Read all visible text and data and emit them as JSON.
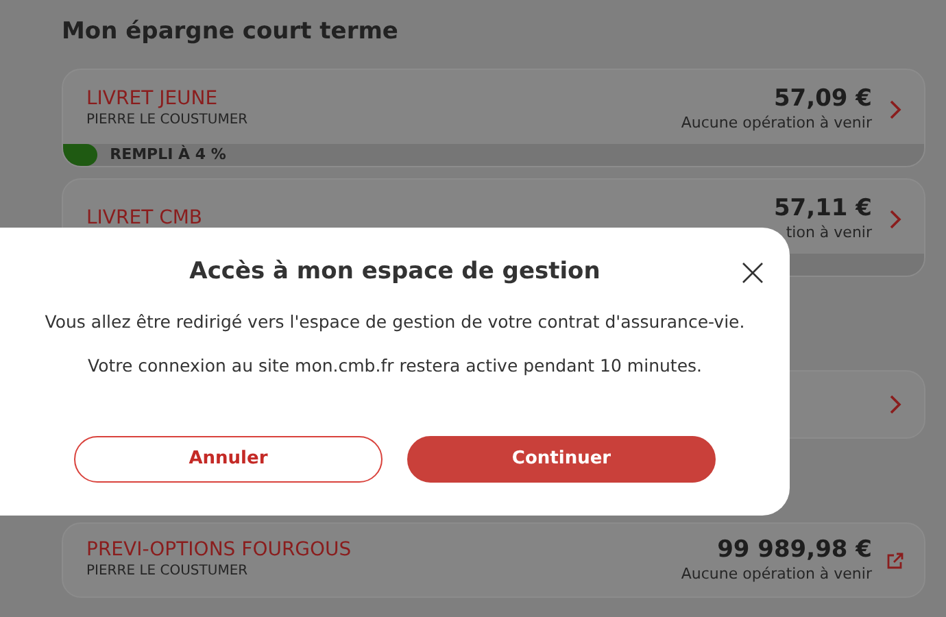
{
  "section_title": "Mon épargne court terme",
  "accounts": [
    {
      "name": "LIVRET JEUNE",
      "holder": "PIERRE LE COUSTUMER",
      "balance": "57,09 €",
      "status": "Aucune opération à venir",
      "kind": "chevron",
      "progress": {
        "label": "REMPLI À 4 %",
        "level": 0.04
      }
    },
    {
      "name": "LIVRET CMB",
      "balance": "57,11 €",
      "status": "tion à venir",
      "kind": "chevron",
      "strip": true
    },
    {
      "kind": "chevron"
    },
    {
      "name": "PREVI-OPTIONS FOURGOUS",
      "holder": "PIERRE LE COUSTUMER",
      "balance": "99 989,98 €",
      "status": "Aucune opération à venir",
      "kind": "external"
    }
  ],
  "dialog": {
    "title": "Accès à mon espace de gestion",
    "paragraphs": [
      "Vous allez être redirigé vers l'espace de gestion de votre contrat d'assurance-vie.",
      "Votre connexion au site mon.cmb.fr restera active pendant 10 minutes."
    ],
    "buttons": [
      {
        "label": "Annuler",
        "kind": "secondary"
      },
      {
        "label": "Continuer",
        "kind": "primary"
      }
    ]
  }
}
